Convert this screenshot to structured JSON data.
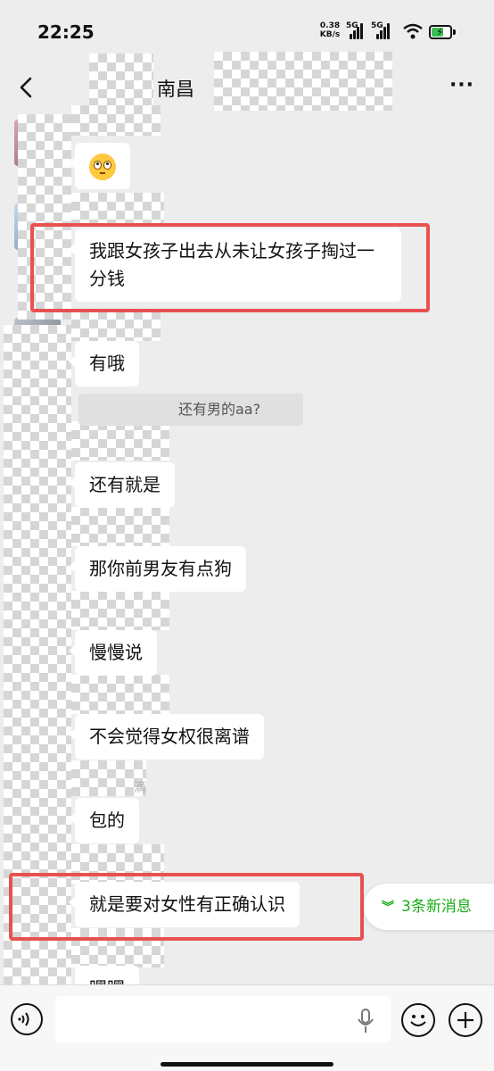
{
  "status_bar": {
    "time": "22:25",
    "net_speed_value": "0.38",
    "net_speed_unit": "KB/s",
    "sim1_label": "5G",
    "sim2_label": "5G",
    "wifi_icon": "wifi-icon",
    "battery_icon": "battery-charging-icon",
    "battery_color": "#3cc152"
  },
  "nav": {
    "title": "南昌",
    "back_icon": "chevron-left-icon",
    "more_icon": "more-dots-icon",
    "more_label": "···"
  },
  "messages": [
    {
      "type": "emoji",
      "emoji_name": "flushed-face-emoji"
    },
    {
      "type": "text",
      "text": "我跟女孩子出去从未让女孩子掏过一分钱",
      "highlighted": true
    },
    {
      "type": "text",
      "text": "有哦"
    },
    {
      "type": "quote",
      "text": "还有男的aa?"
    },
    {
      "type": "text",
      "text": "还有就是"
    },
    {
      "type": "text",
      "text": "那你前男友有点狗"
    },
    {
      "type": "text",
      "text": "慢慢说"
    },
    {
      "type": "text",
      "text": "不会觉得女权很离谱"
    },
    {
      "type": "text",
      "text": "包的"
    },
    {
      "type": "text",
      "text": "就是要对女性有正确认识",
      "highlighted": true
    },
    {
      "type": "text",
      "text": "嘿嘿",
      "partially_visible": true
    }
  ],
  "faint_text": "滴",
  "new_messages": {
    "label": "3条新消息",
    "icon": "double-chevron-down-icon",
    "color": "#1aad19"
  },
  "input_bar": {
    "placeholder": "",
    "voice_icon": "voice-icon",
    "mic_icon": "microphone-icon",
    "emoji_icon": "smiley-icon",
    "plus_icon": "plus-icon"
  },
  "colors": {
    "background": "#ededed",
    "bubble": "#ffffff",
    "highlight_box": "#e8514f"
  }
}
